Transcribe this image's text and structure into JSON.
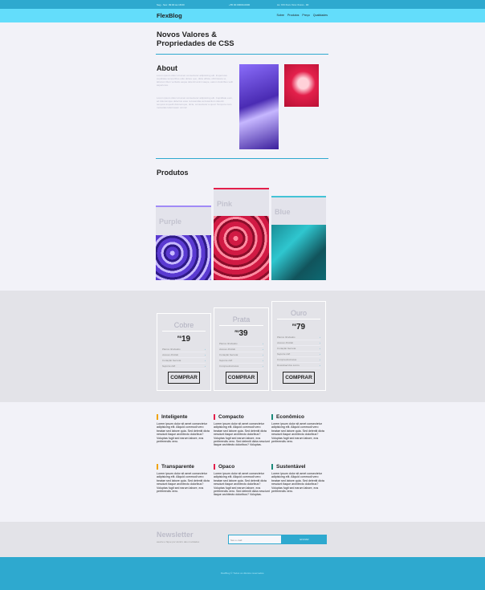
{
  "topbar": {
    "left": "Seg - Sex: 09:00 às 18:00",
    "center": "+55 00 00000-0000",
    "right": "Av. XXI Xxxx Xxxx Xxxxx - 00"
  },
  "nav": {
    "logo": "FlexBlog",
    "menu": [
      "Sobre",
      "Produtos",
      "Preço",
      "Qualidades"
    ]
  },
  "hero": {
    "title": "Novos Valores & Propriedades de CSS"
  },
  "about": {
    "title": "About",
    "p1": "Lorem ipsum dolor sit amet consectetur adipisicing elit. Inspernore cupiditate temporibus odio dolore quo, dicta officia, nihil facere ut, laborum illum veritatis eaque deleniti animi saepe, earum doloribus velit asperiores.",
    "p2": "Lorem ipsum dolor sit amet consectetur adipisicing elit. Cupiditate eum, ad doloremque delectus esse recusandae accusantium deleniti tempora impedit doloremque, dicta, consectetur a quod. Tempore nam molestias laboriosam omnis!"
  },
  "products": {
    "title": "Produtos",
    "items": [
      {
        "name": "Purple",
        "color": "#a18af7"
      },
      {
        "name": "Pink",
        "color": "#e3204b"
      },
      {
        "name": "Blue",
        "color": "#43c3d6"
      }
    ]
  },
  "pricing": {
    "currency": "R$",
    "buy_label": "COMPRAR",
    "plans": [
      {
        "name": "Cobre",
        "price": "19",
        "features": [
          "Planos Ilimitados",
          "Acesso Ilimitdo",
          "Curtação Secreta",
          "Suporte 24h"
        ]
      },
      {
        "name": "Prata",
        "price": "39",
        "features": [
          "Planos Ilimitados",
          "Acesso Ilimitdo",
          "Curtação Secreta",
          "Suporte 24h",
          "Compra Exclusiva"
        ]
      },
      {
        "name": "Ouro",
        "price": "79",
        "features": [
          "Planos Ilimitados",
          "Acesso Ilimitdo",
          "Curtação Secreta",
          "Suporte 24h",
          "Compra Exclusiva",
          "Download dos Livros"
        ]
      }
    ]
  },
  "qualities": [
    {
      "title": "Inteligente",
      "color": "#f0a30a",
      "text": "Lorem ipsum dolor sit amet consectetur adipisicing elit. Aliquid commodi vero beatae sed labore quia. Sed deleniti dicta nesciunt itaque architecto doloribus? Voluptas fugit sed earum labore, eos perferendis vero."
    },
    {
      "title": "Compacto",
      "color": "#e3204b",
      "text": "Lorem ipsum dolor sit amet consectetur adipisicing elit. Aliquid commodi vero beatae sed labore quia. Sed deleniti dicta nesciunt itaque architecto doloribus? Voluptas fugit sed earum labore, eos perferendis vero. Sed deleniti dicta nesciunt itaque architecto doloribus? Voluptas."
    },
    {
      "title": "Econômico",
      "color": "#1b8a7a",
      "text": "Lorem ipsum dolor sit amet consectetur adipisicing elit. Aliquid commodi vero beatae sed labore quia. Sed deleniti dicta nesciunt itaque architecto doloribus? Voluptas fugit sed earum labore, eos perferendis vero."
    },
    {
      "title": "Transparente",
      "color": "#f0a30a",
      "text": "Lorem ipsum dolor sit amet consectetur adipisicing elit. Aliquid commodi vero beatae sed labore quia. Sed deleniti dicta nesciunt itaque architecto doloribus? Voluptas fugit sed earum labore, eos perferendis vero."
    },
    {
      "title": "Opaco",
      "color": "#e3204b",
      "text": "Lorem ipsum dolor sit amet consectetur adipisicing elit. Aliquid commodi vero beatae sed labore quia. Sed deleniti dicta nesciunt itaque architecto doloribus? Voluptas fugit sed earum labore, eos perferendis vero. Sed deleniti dicta nesciunt itaque architecto doloribus? Voluptas."
    },
    {
      "title": "Sustentável",
      "color": "#1b8a7a",
      "text": "Lorem ipsum dolor sit amet consectetur adipisicing elit. Aliquid commodi vero beatae sed labore quia. Sed deleniti dicta nesciunt itaque architecto doloribus? Voluptas fugit sed earum labore, eos perferendis vero."
    }
  ],
  "newsletter": {
    "title": "Newsletter",
    "subtitle": "assine e fique por dentro das novidades",
    "placeholder": "Seu e-mail",
    "button": "ENVIAR"
  },
  "footer": {
    "text": "FlexBlog © Todos os direitos reservados."
  }
}
